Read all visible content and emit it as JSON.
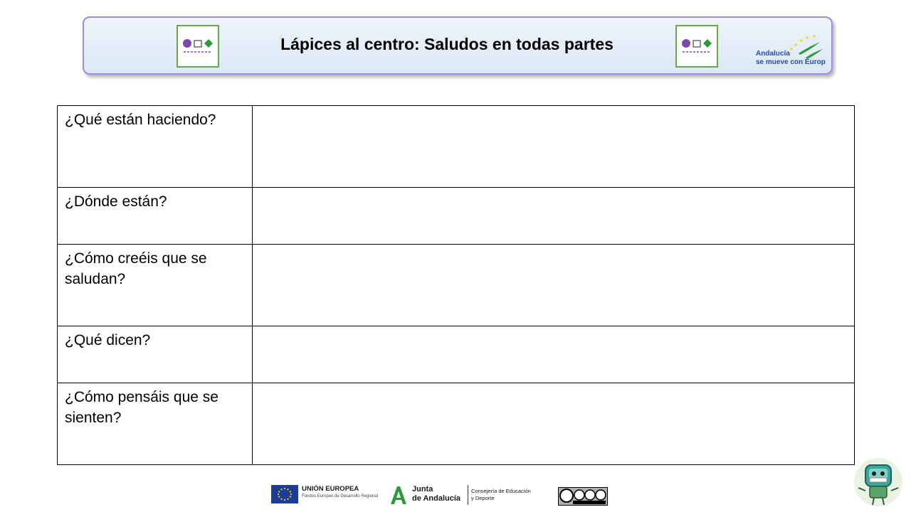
{
  "header": {
    "title": "Lápices al centro: Saludos en todas partes",
    "logo_left": "mta-logo",
    "logo_right": "mta-logo",
    "partner_logo_line1": "Andalucía",
    "partner_logo_line2": "se mueve con Europa"
  },
  "table": {
    "rows": [
      {
        "question": "¿Qué están haciendo?",
        "answer": ""
      },
      {
        "question": "¿Dónde están?",
        "answer": ""
      },
      {
        "question": "¿Cómo creéis que se saludan?",
        "answer": ""
      },
      {
        "question": "¿Qué dicen?",
        "answer": ""
      },
      {
        "question": "¿Cómo pensáis que se sienten?",
        "answer": ""
      }
    ]
  },
  "footer": {
    "eu_title": "UNIÓN EUROPEA",
    "eu_subtitle": "Fondos Europeo de Desarrollo Regional",
    "junta_line1": "Junta",
    "junta_line2": "de Andalucía",
    "consejeria_line1": "Consejería de Educación",
    "consejeria_line2": "y Deporte",
    "license_badge": "cc-by-nc-sa-icon",
    "mascot": "robot-mascot-icon"
  },
  "colors": {
    "banner_border": "#9a8ee0",
    "banner_bg": "#e3edf8",
    "andalucia_green": "#2e9a3c",
    "andalucia_yellow": "#f2d31b",
    "eu_blue": "#1b3d96",
    "eu_star": "#ffd200",
    "table_border": "#000000"
  }
}
